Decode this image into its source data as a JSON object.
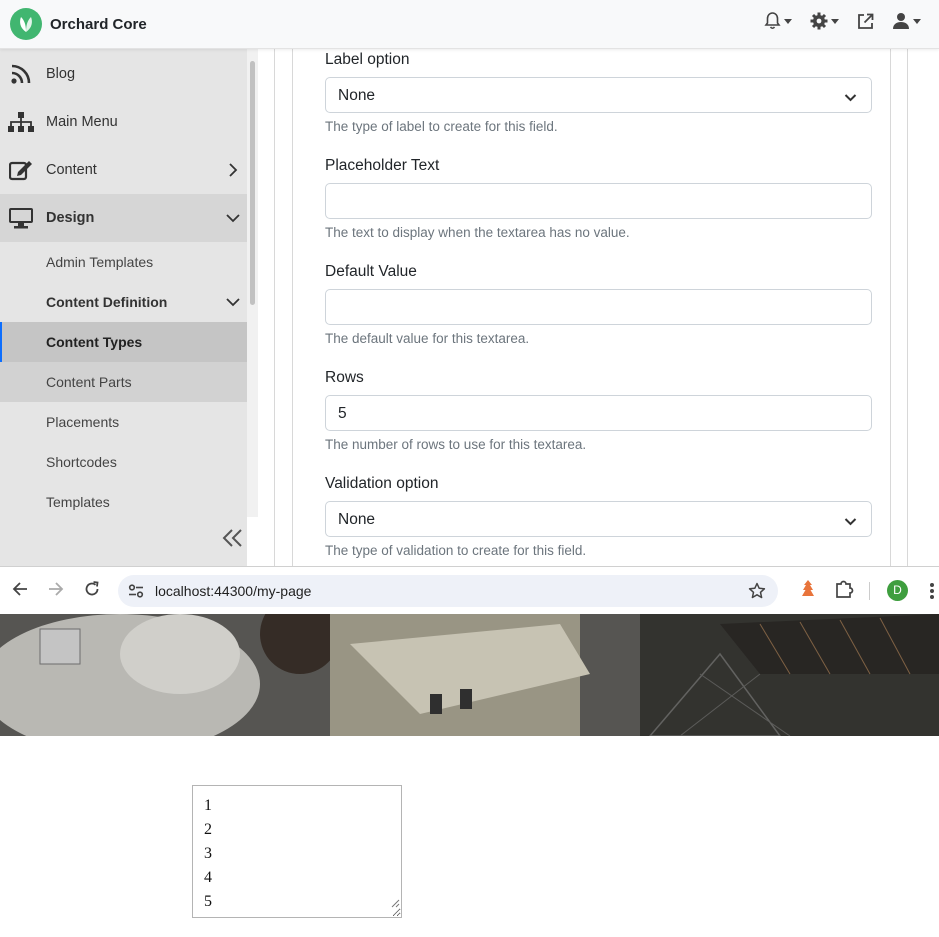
{
  "admin": {
    "brand": "Orchard Core",
    "sidebar": {
      "items": [
        {
          "label": "Blog",
          "icon": "rss-icon"
        },
        {
          "label": "Main Menu",
          "icon": "sitemap-icon"
        },
        {
          "label": "Content",
          "icon": "edit-icon"
        },
        {
          "label": "Design",
          "icon": "monitor-icon"
        }
      ],
      "design_children": [
        "Admin Templates",
        "Content Definition",
        "Content Types",
        "Content Parts",
        "Placements",
        "Shortcodes",
        "Templates"
      ]
    },
    "form": {
      "label_option": {
        "label": "Label option",
        "value": "None",
        "help": "The type of label to create for this field."
      },
      "placeholder": {
        "label": "Placeholder Text",
        "value": "",
        "help": "The text to display when the textarea has no value."
      },
      "default_value": {
        "label": "Default Value",
        "value": "",
        "help": "The default value for this textarea."
      },
      "rows": {
        "label": "Rows",
        "value": "5",
        "help": "The number of rows to use for this textarea."
      },
      "validation": {
        "label": "Validation option",
        "value": "None",
        "help": "The type of validation to create for this field."
      }
    }
  },
  "browser": {
    "url": "localhost:44300/my-page",
    "profile_initial": "D",
    "textarea_lines": [
      "1",
      "2",
      "3",
      "4",
      "5"
    ]
  },
  "colors": {
    "brand": "#41b670",
    "sidebar_bg": "#e5e5e5",
    "active_bg": "#c5c5c5",
    "active_border": "#0d6efd"
  }
}
